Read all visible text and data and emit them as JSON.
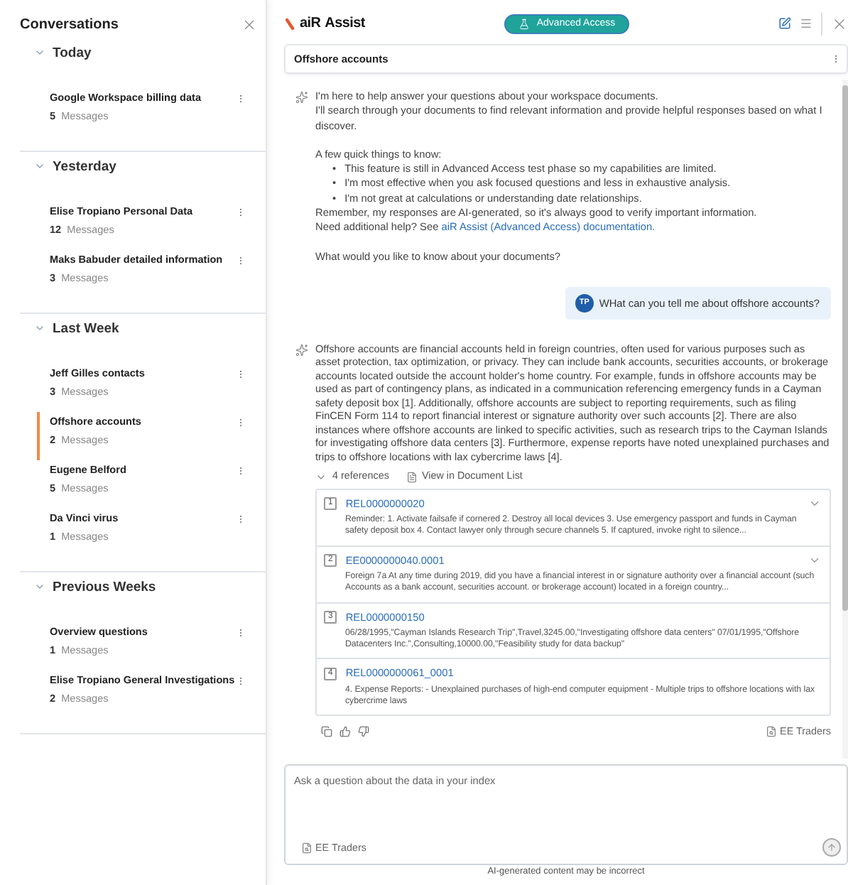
{
  "sidebar": {
    "title": "Conversations",
    "groups": [
      {
        "label": "Today",
        "expanded": true,
        "conversations": [
          {
            "title": "Google Workspace billing data",
            "count": "5",
            "count_label": "Messages",
            "selected": false
          }
        ]
      },
      {
        "label": "Yesterday",
        "expanded": true,
        "conversations": [
          {
            "title": "Elise Tropiano Personal Data",
            "count": "12",
            "count_label": "Messages",
            "selected": false
          },
          {
            "title": "Maks Babuder detailed information",
            "count": "3",
            "count_label": "Messages",
            "selected": false
          }
        ]
      },
      {
        "label": "Last Week",
        "expanded": true,
        "conversations": [
          {
            "title": "Jeff Gilles contacts",
            "count": "3",
            "count_label": "Messages",
            "selected": false
          },
          {
            "title": "Offshore accounts",
            "count": "2",
            "count_label": "Messages",
            "selected": true
          },
          {
            "title": "Eugene Belford",
            "count": "5",
            "count_label": "Messages",
            "selected": false
          },
          {
            "title": "Da Vinci virus",
            "count": "1",
            "count_label": "Messages",
            "selected": false
          }
        ]
      },
      {
        "label": "Previous Weeks",
        "expanded": true,
        "conversations": [
          {
            "title": "Overview questions",
            "count": "1",
            "count_label": "Messages",
            "selected": false
          },
          {
            "title": "Elise Tropiano General Investigations",
            "count": "2",
            "count_label": "Messages",
            "selected": false
          }
        ]
      }
    ]
  },
  "header": {
    "logo": "aiR",
    "app_name": "Assist",
    "badge": "Advanced Access"
  },
  "conversation_title": "Offshore accounts",
  "intro": {
    "lines": [
      "I'm here to help answer your questions about your workspace documents.",
      "I'll search through your documents to find relevant information and provide helpful responses based on what I discover."
    ],
    "tips_heading": "A few quick things to know:",
    "tips": [
      {
        "bullet": "•",
        "text": "This feature is still in Advanced Access test phase so my capabilities are limited."
      },
      {
        "bullet": "•",
        "text": "I'm most effective when you ask focused questions and less in exhaustive analysis."
      },
      {
        "bullet": "•",
        "text": "I'm not great at calculations or understanding date relationships."
      }
    ],
    "reminder": "Remember, my responses are AI-generated, so it's always good to verify important information.",
    "help_prefix": "Need additional help? See",
    "help_link": "aiR Assist (Advanced Access) documentation.",
    "question": "What would you like to know about your documents?"
  },
  "user_message": {
    "initials": "TP",
    "text": "WHat can you tell me about offshore accounts?"
  },
  "answer": {
    "text": "Offshore accounts are financial accounts held in foreign countries, often used for various purposes such as asset protection, tax optimization, or privacy. They can include bank accounts, securities accounts, or brokerage accounts located outside the account holder's home country. For example, funds in offshore accounts may be used as part of contingency plans, as indicated in a communication referencing emergency funds in a Cayman safety deposit box [1]. Additionally, offshore accounts are subject to reporting requirements, such as filing FinCEN Form 114 to report financial interest or signature authority over such accounts [2]. There are also instances where offshore accounts are linked to specific activities, such as research trips to the Cayman Islands for investigating offshore data centers [3]. Furthermore, expense reports have noted unexplained purchases and trips to offshore locations with lax cybercrime laws [4].",
    "references_label": "4 references",
    "references_expanded": true,
    "view_link": "View in Document List",
    "references": [
      {
        "number": "1",
        "id": "REL0000000020",
        "snippet": "Reminder: 1. Activate failsafe if cornered 2. Destroy all local devices 3. Use emergency passport and funds in Cayman safety deposit box 4. Contact lawyer only through secure channels 5. If captured, invoke right to silence...",
        "expandable": true
      },
      {
        "number": "2",
        "id": "EE0000000040.0001",
        "snippet": "Foreign 7a At any time during 2019, did you have a financial interest in or signature authority over a financial account (such Accounts as a bank account, securities account. or brokerage account) located in a foreign country...",
        "expandable": true
      },
      {
        "number": "3",
        "id": "REL0000000150",
        "snippet": "06/28/1995,\"Cayman Islands Research Trip\",Travel,3245.00,\"Investigating offshore data centers\" 07/01/1995,\"Offshore Datacenters Inc.\",Consulting,10000.00,\"Feasibility study for data backup\"",
        "expandable": false
      },
      {
        "number": "4",
        "id": "REL0000000061_0001",
        "snippet": "4. Expense Reports: - Unexplained purchases of high-end computer equipment - Multiple trips to offshore locations with lax cybercrime laws",
        "expandable": false
      }
    ],
    "source": "EE Traders"
  },
  "composer": {
    "placeholder": "Ask a question about the data in your index",
    "index": "EE Traders"
  },
  "disclaimer": "AI-generated content may be incorrect"
}
